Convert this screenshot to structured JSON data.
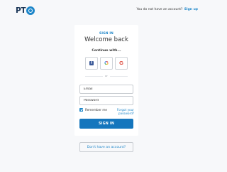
{
  "brand": {
    "logo_text": "PT",
    "logo_color": "#1a3556",
    "badge_color": "#1d86c9"
  },
  "topnav": {
    "question": "You do not have an account?",
    "signup_link": "Sign up"
  },
  "card": {
    "eyebrow": "SIGN IN",
    "title": "Welcome back",
    "continue_with": "Continue with...",
    "social_buttons": [
      {
        "icon": "facebook-icon",
        "glyph": "f"
      },
      {
        "icon": "google-icon",
        "glyph": "G"
      },
      {
        "icon": "google-plus-icon",
        "glyph": "G"
      }
    ],
    "divider_text": "or",
    "email_placeholder": "Email",
    "password_placeholder": "Password",
    "remember_me": "Remember me",
    "remember_checked": true,
    "forgot_password": "Forgot your password?",
    "submit_label": "SIGN IN"
  },
  "secondary": {
    "no_account_label": "Don't have an account?"
  },
  "colors": {
    "accent": "#1d86c9",
    "primary_button": "#1576bd",
    "background": "#f7f8fa"
  }
}
